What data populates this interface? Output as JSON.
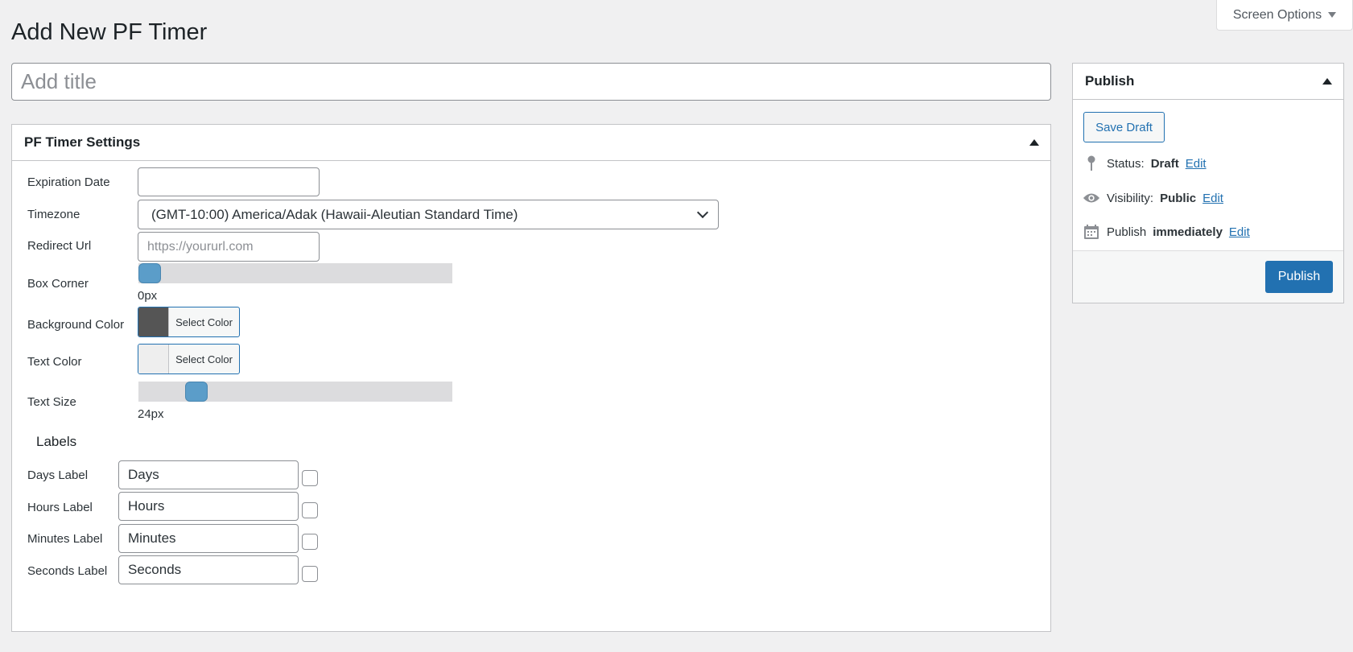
{
  "screen_options": {
    "label": "Screen Options"
  },
  "page": {
    "title": "Add New PF Timer"
  },
  "title_input": {
    "placeholder": "Add title",
    "value": ""
  },
  "settings": {
    "heading": "PF Timer Settings",
    "expiration_date": {
      "label": "Expiration Date",
      "value": ""
    },
    "timezone": {
      "label": "Timezone",
      "selected": "(GMT-10:00) America/Adak (Hawaii-Aleutian Standard Time)"
    },
    "redirect_url": {
      "label": "Redirect Url",
      "placeholder": "https://yoururl.com",
      "value": ""
    },
    "box_corner": {
      "label": "Box Corner",
      "value_text": "0px",
      "level": 0
    },
    "background_color": {
      "label": "Background Color",
      "button": "Select Color",
      "swatch": "#555555"
    },
    "text_color": {
      "label": "Text Color",
      "button": "Select Color",
      "swatch": "#eeeeee"
    },
    "text_size": {
      "label": "Text Size",
      "value_text": "24px",
      "level": 0.16
    },
    "labels_heading": "Labels",
    "labels": [
      {
        "label": "Days Label",
        "value": "Days",
        "checked": false
      },
      {
        "label": "Hours Label",
        "value": "Hours",
        "checked": false
      },
      {
        "label": "Minutes Label",
        "value": "Minutes",
        "checked": false
      },
      {
        "label": "Seconds Label",
        "value": "Seconds",
        "checked": false
      }
    ]
  },
  "publish": {
    "heading": "Publish",
    "save_draft": "Save Draft",
    "status_label": "Status:",
    "status_value": "Draft",
    "visibility_label": "Visibility:",
    "visibility_value": "Public",
    "publish_label": "Publish",
    "publish_value": "immediately",
    "edit": "Edit",
    "publish_button": "Publish"
  },
  "colors": {
    "accent": "#2271b1",
    "slider_handle": "#5b9dc9",
    "background": "#f0f0f1"
  }
}
